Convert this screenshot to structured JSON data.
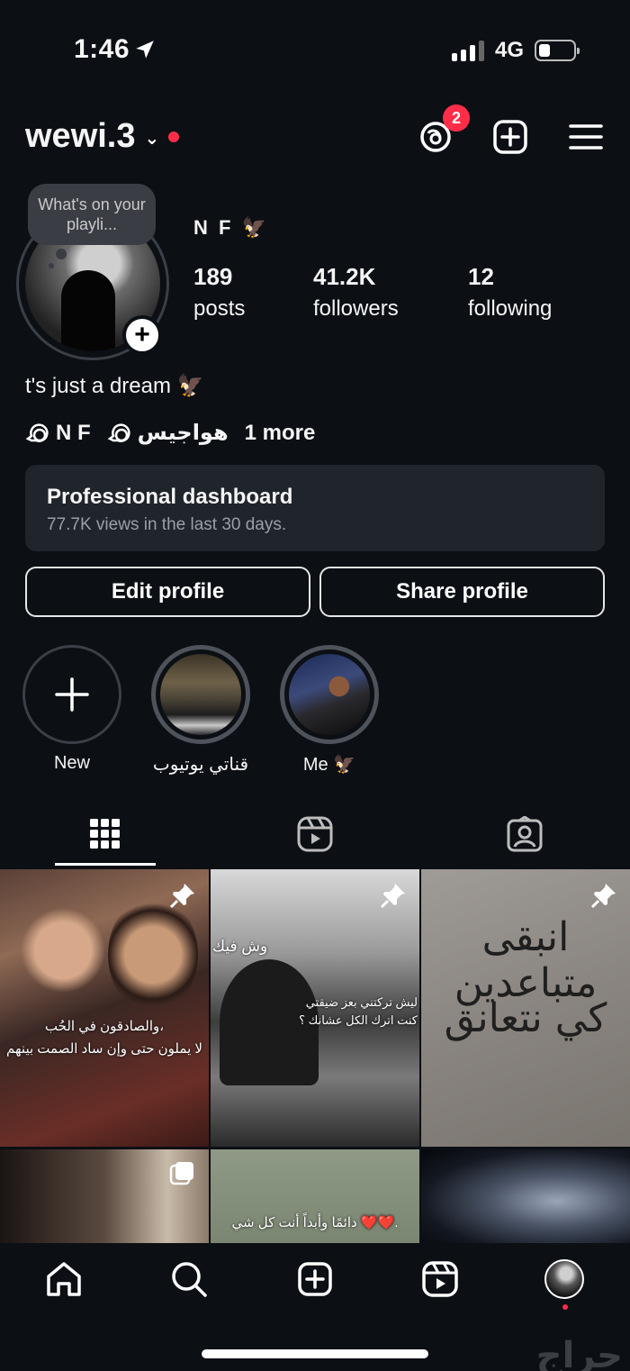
{
  "status_bar": {
    "time": "1:46",
    "network": "4G"
  },
  "header": {
    "username": "wewi.3",
    "threads_badge": "2"
  },
  "profile": {
    "note": "What's on your playli...",
    "display_name": "N F 🦅",
    "stats": [
      {
        "value": "189",
        "label": "posts"
      },
      {
        "value": "41.2K",
        "label": "followers"
      },
      {
        "value": "12",
        "label": "following"
      }
    ],
    "bio": "t's just a dream 🦅",
    "links": [
      {
        "label": "N F"
      },
      {
        "label": "هواجيس"
      }
    ],
    "more_links": "1 more"
  },
  "dashboard": {
    "title": "Professional dashboard",
    "subtitle": "77.7K views in the last 30 days."
  },
  "buttons": {
    "edit": "Edit profile",
    "share": "Share profile"
  },
  "highlights": [
    {
      "label": "New"
    },
    {
      "label": "قناتي يوتيوب"
    },
    {
      "label": "Me 🦅"
    }
  ],
  "grid": [
    {
      "caption_1": "والصادقون في الحُب،",
      "caption_2": "لا يملون حتى وإن ساد الصمت بينهم",
      "pinned": true
    },
    {
      "caption_1": "وش فيك",
      "caption_2": "ليش تركتني بعز ضيقتي",
      "caption_3": "كنت اترك الكل عشانك ؟",
      "pinned": true
    },
    {
      "caption_1": "انبقى متباعدين",
      "caption_2": "كي نتعانق",
      "pinned": true
    },
    {
      "multi": true
    },
    {
      "caption_1": "دائمًا وأبداً أنت كل شي ❤️❤️."
    },
    {}
  ],
  "watermark": "حراج",
  "colors": {
    "background": "#0c0f14",
    "card": "#20242b",
    "badge": "#ff2d48",
    "subtext": "#9aa0a6"
  }
}
